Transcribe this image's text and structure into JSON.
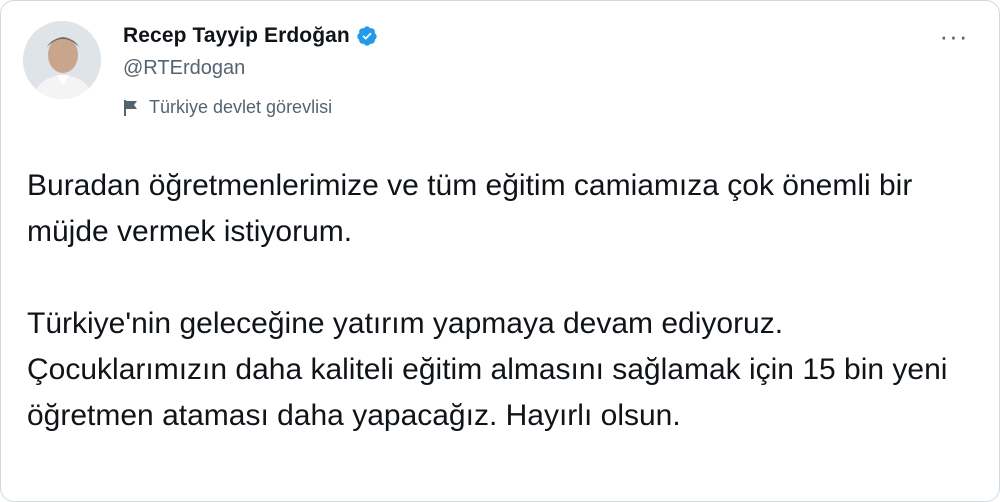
{
  "author": {
    "display_name": "Recep Tayyip Erdoğan",
    "handle": "@RTErdogan",
    "label": "Türkiye devlet görevlisi",
    "verified": true,
    "verified_color": "#1d9bf0"
  },
  "icons": {
    "verified": "verified-badge-icon",
    "label": "flag-icon",
    "more": "more-horizontal-icon"
  },
  "more_glyph": "···",
  "tweet": {
    "paragraphs": [
      "Buradan öğretmenlerimize ve tüm eğitim camiamıza çok önemli bir müjde vermek istiyorum.",
      "Türkiye'nin geleceğine yatırım yapmaya devam ediyoruz. Çocuklarımızın daha kaliteli eğitim almasını sağlamak için 15 bin yeni öğretmen ataması daha yapacağız. Hayırlı olsun."
    ]
  },
  "colors": {
    "text_primary": "#0f1419",
    "text_secondary": "#536471",
    "border": "#cfd9de"
  }
}
